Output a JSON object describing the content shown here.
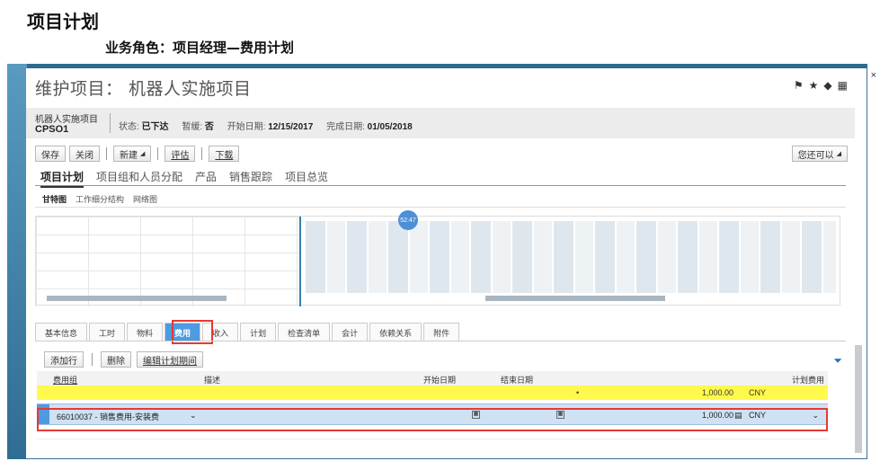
{
  "heading": {
    "main": "项目计划",
    "sub": "业务角色：项目经理—费用计划"
  },
  "window": {
    "title": "维护项目： 机器人实施项目",
    "close": "×",
    "header_icons": [
      "flag-icon",
      "star-icon",
      "tag-icon",
      "share-icon"
    ]
  },
  "info": {
    "project_name": "机器人实施项目",
    "project_code": "CPSO1",
    "status_label": "状态:",
    "status_value": "已下达",
    "block_label": "暂缓:",
    "block_value": "否",
    "start_label": "开始日期:",
    "start_value": "12/15/2017",
    "finish_label": "完成日期:",
    "finish_value": "01/05/2018"
  },
  "toolbar": {
    "save": "保存",
    "close": "关闭",
    "new": "新建",
    "evaluate": "评估",
    "download": "下载",
    "more": "您还可以"
  },
  "main_tabs": [
    "项目计划",
    "项目组和人员分配",
    "产品",
    "销售跟踪",
    "项目总览"
  ],
  "sub_tabs": [
    "甘特图",
    "工作细分结构",
    "网络图"
  ],
  "gantt": {
    "bubble": "52:47",
    "scroll_dots": "..."
  },
  "detail_tabs": [
    "基本信息",
    "工时",
    "物料",
    "费用",
    "收入",
    "计划",
    "检查清单",
    "会计",
    "依赖关系",
    "附件"
  ],
  "detail_toolbar": {
    "add_row": "添加行",
    "delete": "删除",
    "edit_period": "编辑计划期间"
  },
  "grid": {
    "columns": [
      "费用组",
      "描述",
      "开始日期",
      "结束日期",
      "计划费用"
    ],
    "total_row": {
      "amount": "1,000.00",
      "currency": "CNY"
    },
    "rows": [
      {
        "group": "66010037 - 销售费用-安装费",
        "amount": "1,000.00",
        "currency": "CNY"
      }
    ]
  }
}
